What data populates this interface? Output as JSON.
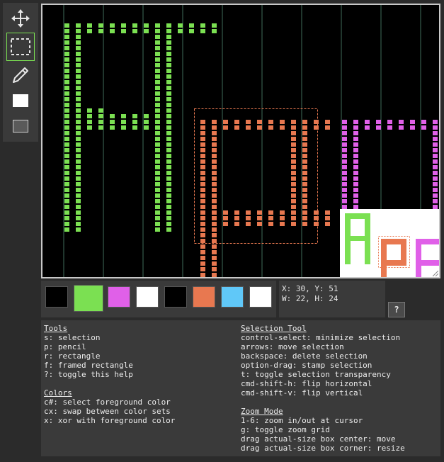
{
  "tools": [
    {
      "name": "move-icon",
      "active": false
    },
    {
      "name": "selection-icon",
      "active": true
    },
    {
      "name": "pencil-icon",
      "active": false
    },
    {
      "name": "rectangle-icon",
      "active": false
    },
    {
      "name": "framed-rectangle-icon",
      "active": false
    }
  ],
  "drawing": {
    "background": "#000000",
    "grid_color": "#3f6b5a",
    "selection_color": "#e87850",
    "letters": [
      {
        "char": "A",
        "color": "#7be052"
      },
      {
        "char": "P",
        "color": "#e87850"
      },
      {
        "char": "P",
        "color": "#e060e8"
      }
    ]
  },
  "preview": {
    "background": "#ffffff"
  },
  "palette": {
    "set_1": [
      "#000000",
      "#7be052",
      "#e060e8",
      "#ffffff"
    ],
    "set_2": [
      "#000000",
      "#e87850",
      "#60c8f8",
      "#ffffff"
    ]
  },
  "status": {
    "cursor": "X: 30, Y: 51",
    "selection_size": "W: 22, H: 24"
  },
  "help_button": "?",
  "help": {
    "tools": {
      "title": "Tools",
      "lines": [
        "s: selection",
        "p: pencil",
        "r: rectangle",
        "f: framed rectangle",
        "?: toggle this help"
      ]
    },
    "colors": {
      "title": "Colors",
      "lines": [
        "c#: select foreground color",
        "cx: swap between color sets",
        "x: xor with foreground color"
      ]
    },
    "selection_tool": {
      "title": "Selection Tool",
      "lines": [
        "control-select: minimize selection",
        "arrows: move selection",
        "backspace: delete selection",
        "option-drag: stamp selection",
        "t: toggle selection transparency",
        "cmd-shift-h: flip horizontal",
        "cmd-shift-v: flip vertical"
      ]
    },
    "zoom_mode": {
      "title": "Zoom Mode",
      "lines": [
        "1-6: zoom in/out at cursor",
        "g: toggle zoom grid",
        "drag actual-size box center: move",
        "drag actual-size box corner: resize"
      ]
    }
  }
}
